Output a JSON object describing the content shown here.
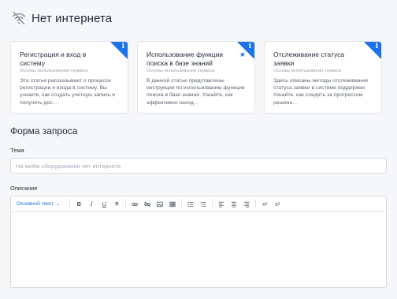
{
  "header": {
    "title": "Нет интернета",
    "icon": "wifi-off-icon"
  },
  "cards": [
    {
      "title": "Регистрация и вход в систему",
      "category": "Основы использования сервиса",
      "description": "Эта статья рассказывает о процессе регистрации и входа в систему. Вы узнаете, как создать учетную запись и получить дос...",
      "starred": false
    },
    {
      "title": "Использование функции поиска в базе знаний",
      "category": "Основы использования сервиса",
      "description": "В данной статье представлены инструкции по использованию функции поиска в базе знаний. Узнайте, как эффективно наход...",
      "starred": true
    },
    {
      "title": "Отслеживание статуса заявки",
      "category": "Основы использования сервиса",
      "description": "Здесь описаны методы отслеживания статуса заявки в системе поддержки. Узнайте, как следить за прогрессом решени...",
      "starred": false
    }
  ],
  "card_badge": "i",
  "form": {
    "title": "Форма запроса",
    "subject_label": "Тема",
    "subject_placeholder": "На моём оборудовании нет интернета",
    "subject_value": "",
    "description_label": "Описание",
    "toolbar": {
      "format_select": "Основной текст",
      "buttons": [
        "bold",
        "italic",
        "underline",
        "strikethrough",
        "link",
        "unlink",
        "image",
        "table",
        "bullet-list",
        "numbered-list",
        "align-left",
        "align-center",
        "align-right",
        "superscript",
        "subscript"
      ]
    }
  },
  "colors": {
    "accent": "#1a73e8",
    "background": "#f6f7f9",
    "card": "#ffffff",
    "border": "#e2e5ea"
  }
}
